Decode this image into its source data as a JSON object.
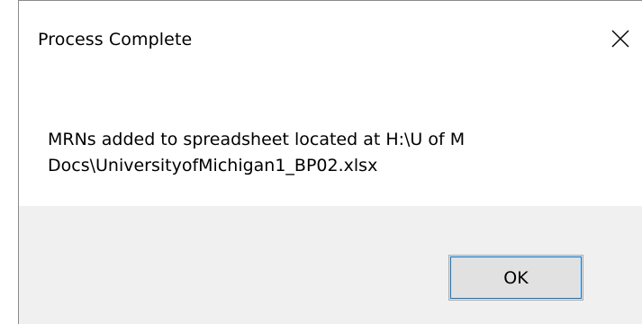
{
  "dialog": {
    "title": "Process Complete",
    "message": "MRNs added to spreadsheet located at H:\\U of M Docs\\UniversityofMichigan1_BP02.xlsx",
    "ok_label": "OK",
    "close_icon": "close-icon"
  }
}
